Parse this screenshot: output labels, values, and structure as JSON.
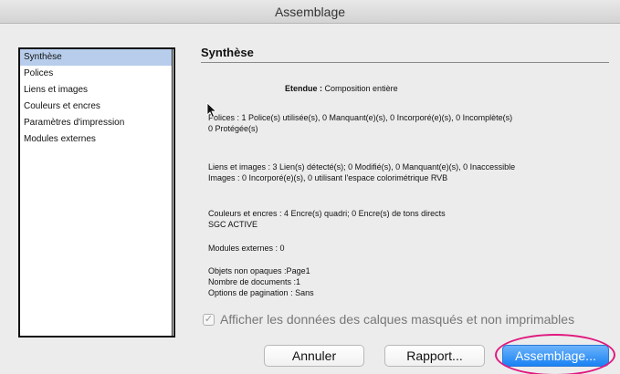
{
  "window": {
    "title": "Assemblage"
  },
  "sidebar": {
    "items": [
      {
        "label": "Synthèse",
        "selected": true
      },
      {
        "label": "Polices",
        "selected": false
      },
      {
        "label": "Liens et images",
        "selected": false
      },
      {
        "label": "Couleurs et encres",
        "selected": false
      },
      {
        "label": "Paramètres d'impression",
        "selected": false
      },
      {
        "label": "Modules externes",
        "selected": false
      }
    ]
  },
  "content": {
    "title": "Synthèse",
    "etendue_label": "Etendue :",
    "etendue_value": "Composition entière",
    "polices_line1": "Polices : 1 Police(s) utilisée(s), 0 Manquant(e)(s), 0 Incorporé(e)(s), 0 Incomplète(s)",
    "polices_line2": "0 Protégée(s)",
    "liens_line1": "Liens et images : 3 Lien(s) détecté(s); 0 Modifié(s), 0 Manquant(e)(s), 0 Inaccessible",
    "liens_line2": "Images : 0 Incorporé(e)(s), 0 utilisant l'espace colorimétrique RVB",
    "couleurs_line1": "Couleurs et encres : 4 Encre(s) quadri; 0 Encre(s) de tons directs",
    "couleurs_line2": "SGC ACTIVE",
    "modules_line": "Modules externes : 0",
    "objets_line1": "Objets non opaques :Page1",
    "objets_line2": "Nombre de documents :1",
    "objets_line3": "Options de pagination : Sans"
  },
  "checkbox": {
    "label": "Afficher les données des calques masqués et non imprimables",
    "checked": true
  },
  "buttons": {
    "cancel": "Annuler",
    "report": "Rapport...",
    "package": "Assemblage..."
  },
  "colors": {
    "primary_button": "#1a82f4",
    "highlight_ring": "#e0197e",
    "selection": "#b7cdeb"
  }
}
